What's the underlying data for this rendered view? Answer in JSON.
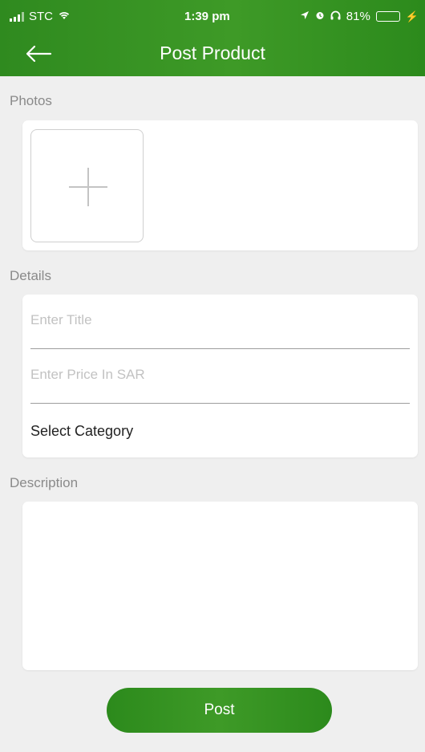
{
  "status_bar": {
    "carrier": "STC",
    "time": "1:39 pm",
    "battery": "81%",
    "battery_level": 0.81
  },
  "header": {
    "title": "Post Product",
    "back_icon": "arrow-left-icon"
  },
  "sections": {
    "photos_label": "Photos",
    "details_label": "Details",
    "description_label": "Description"
  },
  "photos": {
    "add_icon": "plus-icon"
  },
  "details": {
    "title_placeholder": "Enter Title",
    "price_placeholder": "Enter Price In SAR",
    "category": "Select Category"
  },
  "actions": {
    "post_label": "Post"
  },
  "colors": {
    "brand_green": "#3e9a27",
    "background": "#efefef"
  }
}
